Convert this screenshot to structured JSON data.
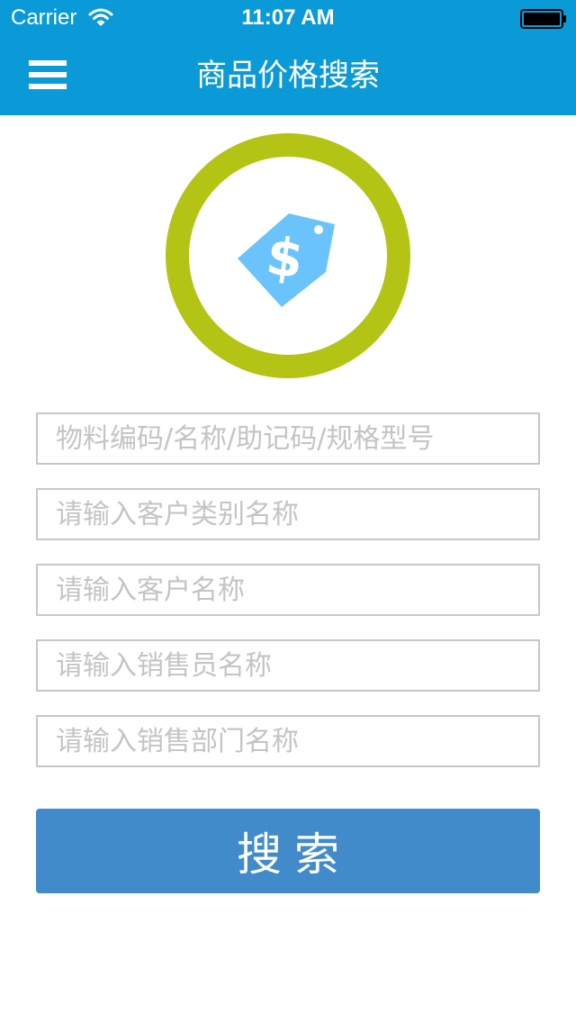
{
  "status_bar": {
    "carrier": "Carrier",
    "time": "11:07 AM"
  },
  "nav": {
    "title": "商品价格搜索"
  },
  "icons": {
    "menu": "hamburger-menu-icon",
    "logo": "price-tag-dollar-icon"
  },
  "form": {
    "fields": [
      {
        "placeholder": "物料编码/名称/助记码/规格型号",
        "value": ""
      },
      {
        "placeholder": "请输入客户类别名称",
        "value": ""
      },
      {
        "placeholder": "请输入客户名称",
        "value": ""
      },
      {
        "placeholder": "请输入销售员名称",
        "value": ""
      },
      {
        "placeholder": "请输入销售部门名称",
        "value": ""
      }
    ],
    "search_label": "搜索"
  },
  "colors": {
    "header": "#0a9ad8",
    "ring": "#b4c414",
    "tag": "#6ac3fb",
    "button": "#418bcb",
    "field_border": "#c8c8c8",
    "placeholder": "#c4c4c4"
  }
}
